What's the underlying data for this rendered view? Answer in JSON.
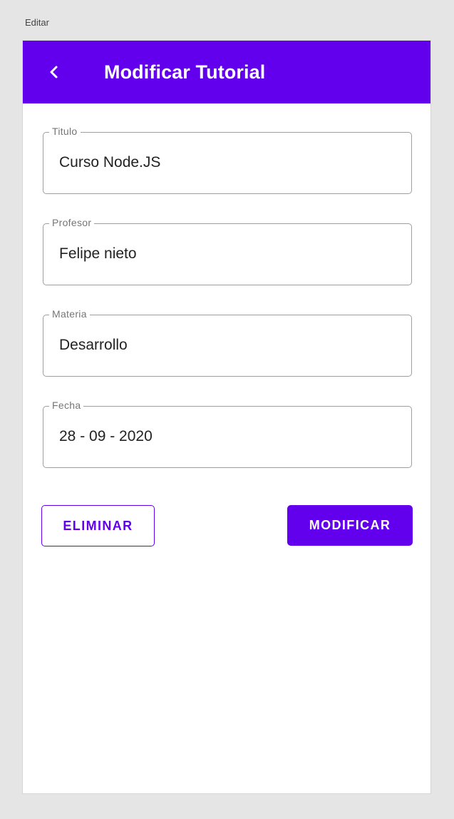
{
  "canvas": {
    "label": "Editar"
  },
  "app_bar": {
    "back_icon": "chevron-left-icon",
    "title": "Modificar Tutorial",
    "color": "#6200ee"
  },
  "form": {
    "fields": [
      {
        "label": "Titulo",
        "value": "Curso Node.JS"
      },
      {
        "label": "Profesor",
        "value": "Felipe nieto"
      },
      {
        "label": "Materia",
        "value": "Desarrollo"
      },
      {
        "label": "Fecha",
        "value": "28 - 09 - 2020"
      }
    ]
  },
  "actions": {
    "delete_label": "ELIMINAR",
    "modify_label": "MODIFICAR"
  },
  "colors": {
    "primary": "#6200ee",
    "background": "#e5e5e5",
    "surface": "#ffffff",
    "outline": "#9e9e9e"
  }
}
